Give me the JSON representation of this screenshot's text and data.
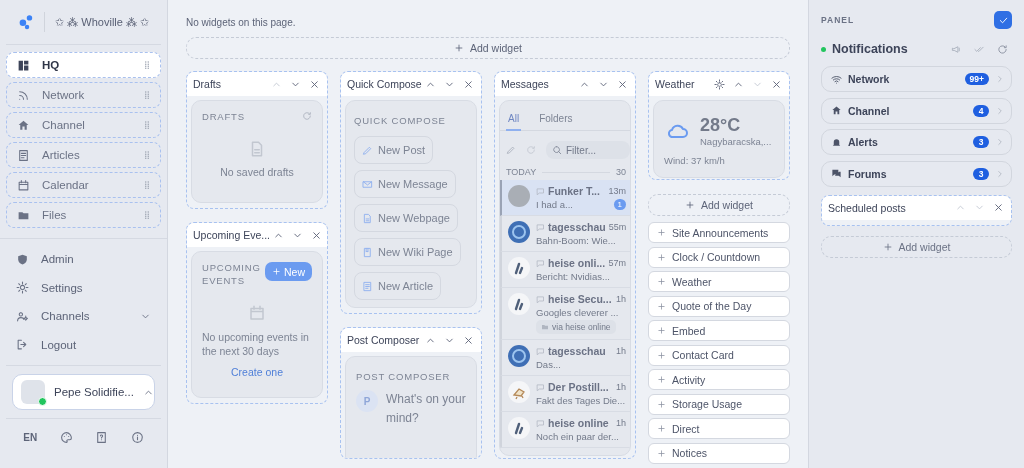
{
  "sidebar": {
    "brand": "✩ ⁂ Whoville ⁂ ✩",
    "nav": [
      {
        "label": "HQ",
        "selected": true
      },
      {
        "label": "Network",
        "selected": false
      },
      {
        "label": "Channel",
        "selected": false
      },
      {
        "label": "Articles",
        "selected": false
      },
      {
        "label": "Calendar",
        "selected": false
      },
      {
        "label": "Files",
        "selected": false
      }
    ],
    "menu": [
      {
        "label": "Admin",
        "kind": "link"
      },
      {
        "label": "Settings",
        "kind": "link"
      },
      {
        "label": "Channels",
        "kind": "group",
        "expanded": false
      },
      {
        "label": "Logout",
        "kind": "link"
      }
    ],
    "user": {
      "name": "Pepe Solidifie...",
      "online": true
    },
    "language": "EN"
  },
  "main": {
    "notice": "No widgets on this page.",
    "add_widget": "Add widget",
    "columns": [
      {
        "widgets": [
          {
            "kind": "drafts",
            "title": "Drafts",
            "up_disabled": true,
            "down_disabled": false,
            "heading": "DRAFTS",
            "empty": "No saved drafts"
          },
          {
            "kind": "events",
            "title": "Upcoming Eve...",
            "up_disabled": false,
            "down_disabled": false,
            "heading": "UPCOMING EVENTS",
            "new_button": "New",
            "empty": "No upcoming events in the next 30 days",
            "link": "Create one"
          }
        ]
      },
      {
        "widgets": [
          {
            "kind": "compose",
            "title": "Quick Compose",
            "up_disabled": false,
            "down_disabled": false,
            "heading": "QUICK COMPOSE",
            "actions": [
              "New Post",
              "New Message",
              "New Webpage",
              "New Wiki Page",
              "New Article"
            ]
          },
          {
            "kind": "composer",
            "title": "Post Composer",
            "up_disabled": false,
            "down_disabled": false,
            "heading": "POST COMPOSER",
            "avatar": "P",
            "placeholder": "What's on your mind?"
          }
        ]
      },
      {
        "widgets": [
          {
            "kind": "messages",
            "title": "Messages",
            "up_disabled": false,
            "down_disabled": false,
            "tabs": [
              {
                "label": "All",
                "selected": true
              },
              {
                "label": "Folders",
                "selected": false
              }
            ],
            "filter_placeholder": "Filter...",
            "section": "TODAY",
            "count": "30",
            "items": [
              {
                "kind": "photo",
                "sender": "Funker T...",
                "time": "13m",
                "preview": "I had a...",
                "badge": "1",
                "selected": true
              },
              {
                "kind": "disc",
                "sender": "tagesschau",
                "time": "55m",
                "preview": "Bahn-Boom: Wie...",
                "selected": false
              },
              {
                "kind": "mark",
                "sender": "heise onli...",
                "time": "57m",
                "preview": "Bericht: Nvidias...",
                "selected": false
              },
              {
                "kind": "mark",
                "sender": "heise Secu...",
                "time": "1h",
                "preview": "Googles cleverer ...",
                "tag": "via heise online",
                "selected": false
              },
              {
                "kind": "disc",
                "sender": "tagesschau",
                "time": "1h",
                "preview": "Das...",
                "selected": false
              },
              {
                "kind": "sketch",
                "sender": "Der Postill...",
                "time": "1h",
                "preview": "Fakt des Tages Die...",
                "selected": false
              },
              {
                "kind": "mark",
                "sender": "heise online",
                "time": "1h",
                "preview": "Noch ein paar der...",
                "selected": false
              }
            ]
          }
        ]
      },
      {
        "widgets": [
          {
            "kind": "weather",
            "title": "Weather",
            "up_disabled": false,
            "down_disabled": true,
            "temperature": "28°C",
            "location": "Nagybaracska,...",
            "wind": "Wind: 37 km/h"
          },
          {
            "kind": "add",
            "label": "Add widget"
          },
          {
            "kind": "catalog",
            "items": [
              "Site Announcements",
              "Clock / Countdown",
              "Weather",
              "Quote of the Day",
              "Embed",
              "Contact Card",
              "Activity",
              "Storage Usage",
              "Direct",
              "Notices"
            ]
          }
        ]
      }
    ]
  },
  "panel": {
    "heading": "PANEL",
    "edit_mode": true,
    "notifications": {
      "title": "Notifications",
      "online": true,
      "items": [
        {
          "label": "Network",
          "count": "99+"
        },
        {
          "label": "Channel",
          "count": "4"
        },
        {
          "label": "Alerts",
          "count": "3"
        },
        {
          "label": "Forums",
          "count": "3"
        }
      ]
    },
    "widgets": [
      {
        "title": "Scheduled posts",
        "up_disabled": true,
        "down_disabled": true
      }
    ],
    "add_widget": "Add widget"
  }
}
